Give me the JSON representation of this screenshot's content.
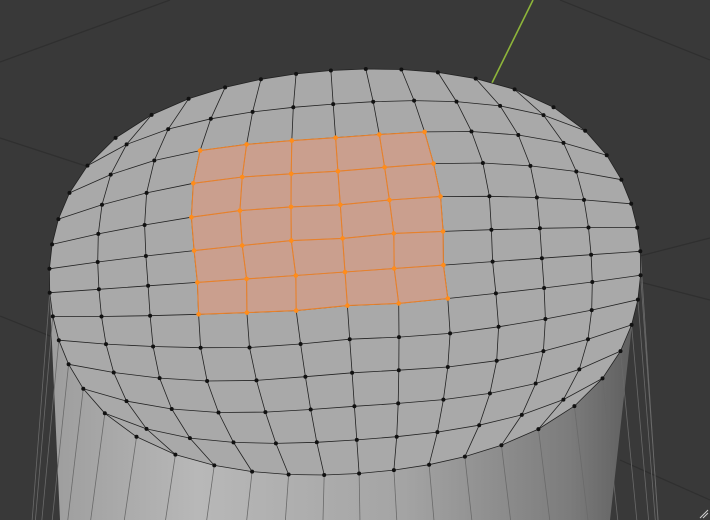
{
  "app": "3d-modeling-editor",
  "editor": {
    "mode": "edit-mode",
    "select_mode": "vertex",
    "object": "cylinder",
    "topology": "quad-grid-cap"
  },
  "selection": {
    "grid_rows": 5,
    "grid_cols": 5,
    "highlight_color": "#e8812a",
    "face_fill_color": "#d59c86",
    "vertex_color": "#ff8c1a"
  },
  "colors": {
    "background": "#393939",
    "grid_line": "#2f2f2f",
    "axis_y": "#8db43a",
    "mesh_face": "#a9a9a9",
    "mesh_edge": "#222222",
    "vertex": "#111111",
    "side_light": "#b5b5b5",
    "side_dark": "#5e5e5e"
  },
  "icons": {
    "corner_widget": "area-split-corner-icon"
  }
}
